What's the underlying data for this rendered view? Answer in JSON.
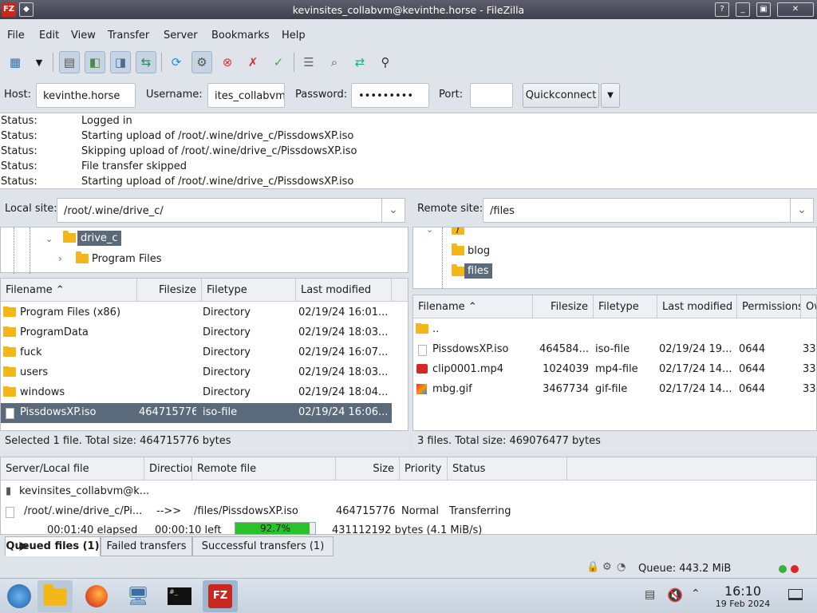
{
  "window": {
    "title": "kevinsites_collabvm@kevinthe.horse - FileZilla",
    "app_icon": "FZ"
  },
  "menu": [
    "File",
    "Edit",
    "View",
    "Transfer",
    "Server",
    "Bookmarks",
    "Help"
  ],
  "toolbar": {
    "icons": [
      "site-manager-icon",
      "dropdown-arrow-icon",
      "toggle-log-icon",
      "toggle-local-tree-icon",
      "toggle-remote-tree-icon",
      "toggle-queue-icon",
      "refresh-icon",
      "process-queue-icon",
      "cancel-icon",
      "disconnect-icon",
      "reconnect-icon",
      "filter-icon",
      "compare-icon",
      "sync-browse-icon",
      "find-icon"
    ]
  },
  "quickconnect": {
    "host_label": "Host:",
    "host_value": "kevinthe.horse",
    "username_label": "Username:",
    "username_value": "ites_collabvm",
    "password_label": "Password:",
    "password_value": "•••••••••",
    "port_label": "Port:",
    "port_value": "",
    "button": "Quickconnect"
  },
  "log": [
    {
      "k": "Status:",
      "v": "Logged in"
    },
    {
      "k": "Status:",
      "v": "Starting upload of /root/.wine/drive_c/PissdowsXP.iso"
    },
    {
      "k": "Status:",
      "v": "Skipping upload of /root/.wine/drive_c/PissdowsXP.iso"
    },
    {
      "k": "Status:",
      "v": "File transfer skipped"
    },
    {
      "k": "Status:",
      "v": "Starting upload of /root/.wine/drive_c/PissdowsXP.iso"
    }
  ],
  "local": {
    "label": "Local site:",
    "path": "/root/.wine/drive_c/",
    "tree": [
      {
        "name": "drive_c",
        "selected": true
      },
      {
        "name": "Program Files"
      }
    ],
    "columns": [
      "Filename",
      "Filesize",
      "Filetype",
      "Last modified"
    ],
    "files": [
      {
        "name": "Program Files (x86)",
        "size": "",
        "type": "Directory",
        "modified": "02/19/24 16:01...",
        "icon": "folder"
      },
      {
        "name": "ProgramData",
        "size": "",
        "type": "Directory",
        "modified": "02/19/24 18:03...",
        "icon": "folder"
      },
      {
        "name": "fuck",
        "size": "",
        "type": "Directory",
        "modified": "02/19/24 16:07...",
        "icon": "folder"
      },
      {
        "name": "users",
        "size": "",
        "type": "Directory",
        "modified": "02/19/24 18:03...",
        "icon": "folder"
      },
      {
        "name": "windows",
        "size": "",
        "type": "Directory",
        "modified": "02/19/24 18:04...",
        "icon": "folder"
      },
      {
        "name": "PissdowsXP.iso",
        "size": "464715776",
        "type": "iso-file",
        "modified": "02/19/24 16:06...",
        "icon": "file",
        "selected": true
      }
    ],
    "status": "Selected 1 file. Total size: 464715776 bytes"
  },
  "remote": {
    "label": "Remote site:",
    "path": "/files",
    "tree": [
      {
        "name": "/"
      },
      {
        "name": "blog"
      },
      {
        "name": "files",
        "selected": true
      }
    ],
    "columns": [
      "Filename",
      "Filesize",
      "Filetype",
      "Last modified",
      "Permissions",
      "Ow"
    ],
    "files": [
      {
        "name": "..",
        "size": "",
        "type": "",
        "modified": "",
        "perm": "",
        "owner": "",
        "icon": "folder"
      },
      {
        "name": "PissdowsXP.iso",
        "size": "464584...",
        "type": "iso-file",
        "modified": "02/19/24 19...",
        "perm": "0644",
        "owner": "33",
        "icon": "file"
      },
      {
        "name": "clip0001.mp4",
        "size": "1024039",
        "type": "mp4-file",
        "modified": "02/17/24 14...",
        "perm": "0644",
        "owner": "33",
        "icon": "video"
      },
      {
        "name": "mbg.gif",
        "size": "3467734",
        "type": "gif-file",
        "modified": "02/17/24 14...",
        "perm": "0644",
        "owner": "33",
        "icon": "gif"
      }
    ],
    "status": "3 files. Total size: 469076477 bytes"
  },
  "queue": {
    "columns": [
      "Server/Local file",
      "Directior",
      "Remote file",
      "Size",
      "Priority",
      "Status"
    ],
    "server": "kevinsites_collabvm@k...",
    "item": {
      "local": "/root/.wine/drive_c/Pi...",
      "dir": "-->>",
      "remote": "/files/PissdowsXP.iso",
      "size": "464715776",
      "priority": "Normal",
      "status": "Transferring"
    },
    "progress": {
      "elapsed": "00:01:40 elapsed",
      "left": "00:00:10 left",
      "percent_text": "92.7%",
      "percent": 92.7,
      "bytes": "431112192 bytes (4.1 MiB/s)"
    },
    "tabs": [
      "Queued files (1)",
      "Failed transfers",
      "Successful transfers (1)"
    ]
  },
  "statusbar": {
    "queue": "Queue: 443.2 MiB"
  },
  "taskbar": {
    "time": "16:10",
    "date": "19 Feb 2024"
  }
}
